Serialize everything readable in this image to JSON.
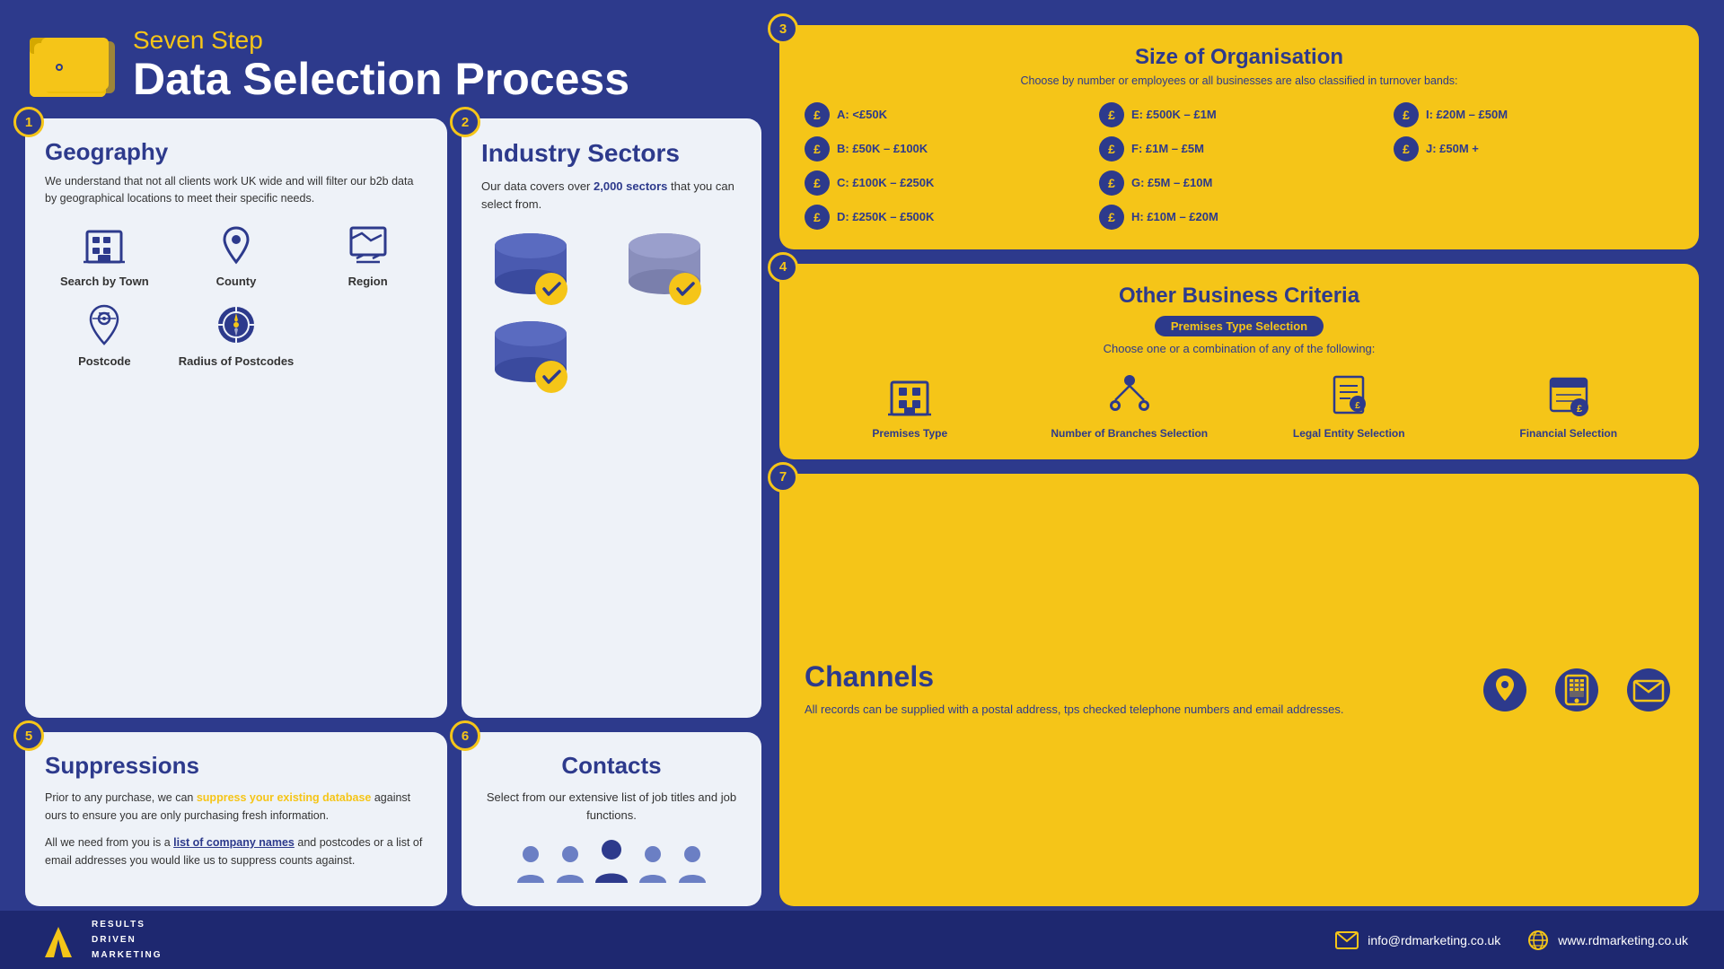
{
  "header": {
    "subtitle": "Seven Step",
    "title": "Data Selection Process",
    "icon_alt": "folder-icon"
  },
  "steps": {
    "geography": {
      "badge": "1",
      "title": "Geography",
      "text": "We understand that not all clients work UK wide and will filter our b2b data by geographical locations to meet their specific needs.",
      "items": [
        {
          "label": "Search by Town",
          "icon": "building"
        },
        {
          "label": "County",
          "icon": "map-pin"
        },
        {
          "label": "Region",
          "icon": "map-region"
        },
        {
          "label": "Postcode",
          "icon": "map-search"
        },
        {
          "label": "Radius of Postcodes",
          "icon": "compass"
        }
      ]
    },
    "industry": {
      "badge": "2",
      "title": "Industry Sectors",
      "text_part1": "Our data covers over ",
      "text_bold": "2,000 sectors",
      "text_part2": " that you can select from."
    },
    "size": {
      "badge": "3",
      "title": "Size of Organisation",
      "subtitle": "Choose by number or employees or all businesses are also classified in turnover bands:",
      "items": [
        {
          "label": "A: <£50K"
        },
        {
          "label": "E: £500K – £1M"
        },
        {
          "label": "I: £20M – £50M"
        },
        {
          "label": "B: £50K – £100K"
        },
        {
          "label": "F: £1M – £5M"
        },
        {
          "label": "J: £50M +"
        },
        {
          "label": "C: £100K – £250K"
        },
        {
          "label": "G: £5M – £10M"
        },
        {
          "label": ""
        },
        {
          "label": "D: £250K – £500K"
        },
        {
          "label": "H: £10M – £20M"
        },
        {
          "label": ""
        }
      ]
    },
    "other_biz": {
      "badge": "4",
      "title": "Other Business Criteria",
      "badge_label": "Premises Type Selection",
      "subtitle": "Choose one or a combination of any of the following:",
      "items": [
        {
          "label": "Premises Type",
          "icon": "building"
        },
        {
          "label": "Number of Branches Selection",
          "icon": "branches"
        },
        {
          "label": "Legal Entity Selection",
          "icon": "legal"
        },
        {
          "label": "Financial Selection",
          "icon": "financial"
        }
      ]
    },
    "suppressions": {
      "badge": "5",
      "title": "Suppressions",
      "text1": "Prior to any purchase, we can ",
      "text1_link": "suppress your existing database",
      "text1_end": " against ours to ensure you are only purchasing fresh information.",
      "text2_start": "All we need from you is a ",
      "text2_link": "list of company names",
      "text2_end": " and postcodes or a list of email addresses you would like us to suppress counts against."
    },
    "contacts": {
      "badge": "6",
      "title": "Contacts",
      "text": "Select from our extensive list of job titles and job functions."
    },
    "channels": {
      "badge": "7",
      "title": "Channels",
      "text": "All records can be supplied with a postal address, tps checked telephone numbers and email addresses."
    }
  },
  "footer": {
    "logo_text": "RESULTS\nDRIVEN\nMARKETING",
    "email": "info@rdmarketing.co.uk",
    "website": "www.rdmarketing.co.uk"
  }
}
